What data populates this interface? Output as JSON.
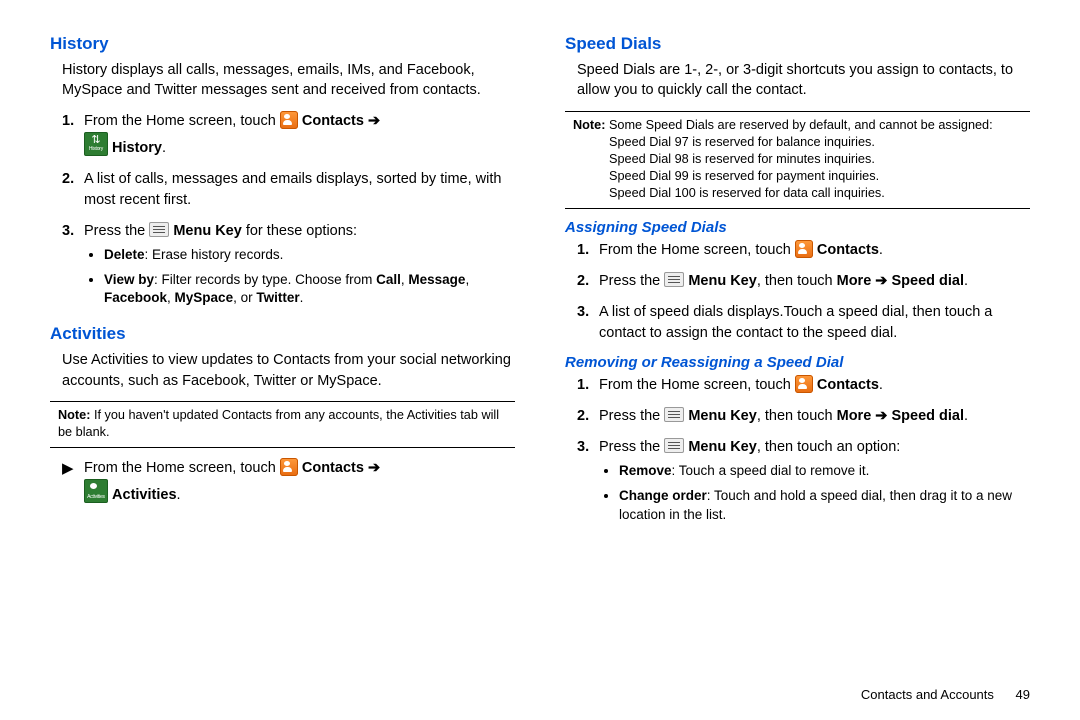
{
  "left": {
    "history": {
      "heading": "History",
      "intro": "History displays all calls, messages, emails, IMs, and Facebook, MySpace and Twitter messages sent and received from contacts.",
      "step1_a": "From the Home screen, touch ",
      "step1_b": "Contacts",
      "step1_c": " ➔",
      "step1_d": "History",
      "step2": "A list of calls, messages and emails displays, sorted by time, with most recent first.",
      "step3_a": "Press the ",
      "step3_b": "Menu Key",
      "step3_c": " for these options:",
      "opt_delete_a": "Delete",
      "opt_delete_b": ": Erase history records.",
      "opt_view_a": "View by",
      "opt_view_b": ": Filter records by type. Choose from ",
      "opt_view_c1": "Call",
      "opt_view_c2": ", ",
      "opt_view_c3": "Message",
      "opt_view_c4": ", ",
      "opt_view_c5": "Facebook",
      "opt_view_c6": ", ",
      "opt_view_c7": "MySpace",
      "opt_view_c8": ", or ",
      "opt_view_c9": "Twitter",
      "opt_view_c10": "."
    },
    "activities": {
      "heading": "Activities",
      "intro": "Use Activities to view updates to Contacts from your social networking accounts, such as Facebook, Twitter or MySpace.",
      "note_a": "Note:",
      "note_b": " If you haven't updated Contacts from any accounts, the Activities tab will be blank.",
      "step_a": "From the Home screen, touch ",
      "step_b": "Contacts",
      "step_c": " ➔",
      "step_d": "Activities",
      "step_e": "."
    }
  },
  "right": {
    "speed": {
      "heading": "Speed Dials",
      "intro": "Speed Dials are 1-, 2-, or 3-digit shortcuts you assign to contacts, to allow you to quickly call the contact.",
      "note_a": "Note:",
      "note_b": " Some Speed Dials are reserved by default, and cannot be assigned:",
      "note_l1": "Speed Dial 97 is reserved for balance inquiries.",
      "note_l2": "Speed Dial 98 is reserved for minutes inquiries.",
      "note_l3": "Speed Dial 99 is reserved for payment inquiries.",
      "note_l4": "Speed Dial 100 is reserved for data call inquiries."
    },
    "assign": {
      "heading": "Assigning Speed Dials",
      "s1a": "From the Home screen, touch ",
      "s1b": "Contacts",
      "s1c": ".",
      "s2a": "Press the ",
      "s2b": "Menu Key",
      "s2c": ", then touch ",
      "s2d": "More",
      "s2e": " ➔ ",
      "s2f": "Speed dial",
      "s2g": ".",
      "s3": "A list of speed dials displays.Touch a speed dial, then touch a contact to assign the contact to the speed dial."
    },
    "remove": {
      "heading": "Removing or Reassigning a Speed Dial",
      "s1a": "From the Home screen, touch ",
      "s1b": "Contacts",
      "s1c": ".",
      "s2a": "Press the ",
      "s2b": "Menu Key",
      "s2c": ", then touch ",
      "s2d": "More",
      "s2e": " ➔ ",
      "s2f": "Speed dial",
      "s2g": ".",
      "s3a": "Press the ",
      "s3b": "Menu Key",
      "s3c": ", then touch an option:",
      "o1a": "Remove",
      "o1b": ": Touch a speed dial to remove it.",
      "o2a": "Change order",
      "o2b": ": Touch and hold a speed dial, then drag it to a new location in the list."
    }
  },
  "footer": {
    "section": "Contacts and Accounts",
    "page": "49"
  },
  "icons": {
    "history_label": "History",
    "activities_label": "Activities"
  }
}
